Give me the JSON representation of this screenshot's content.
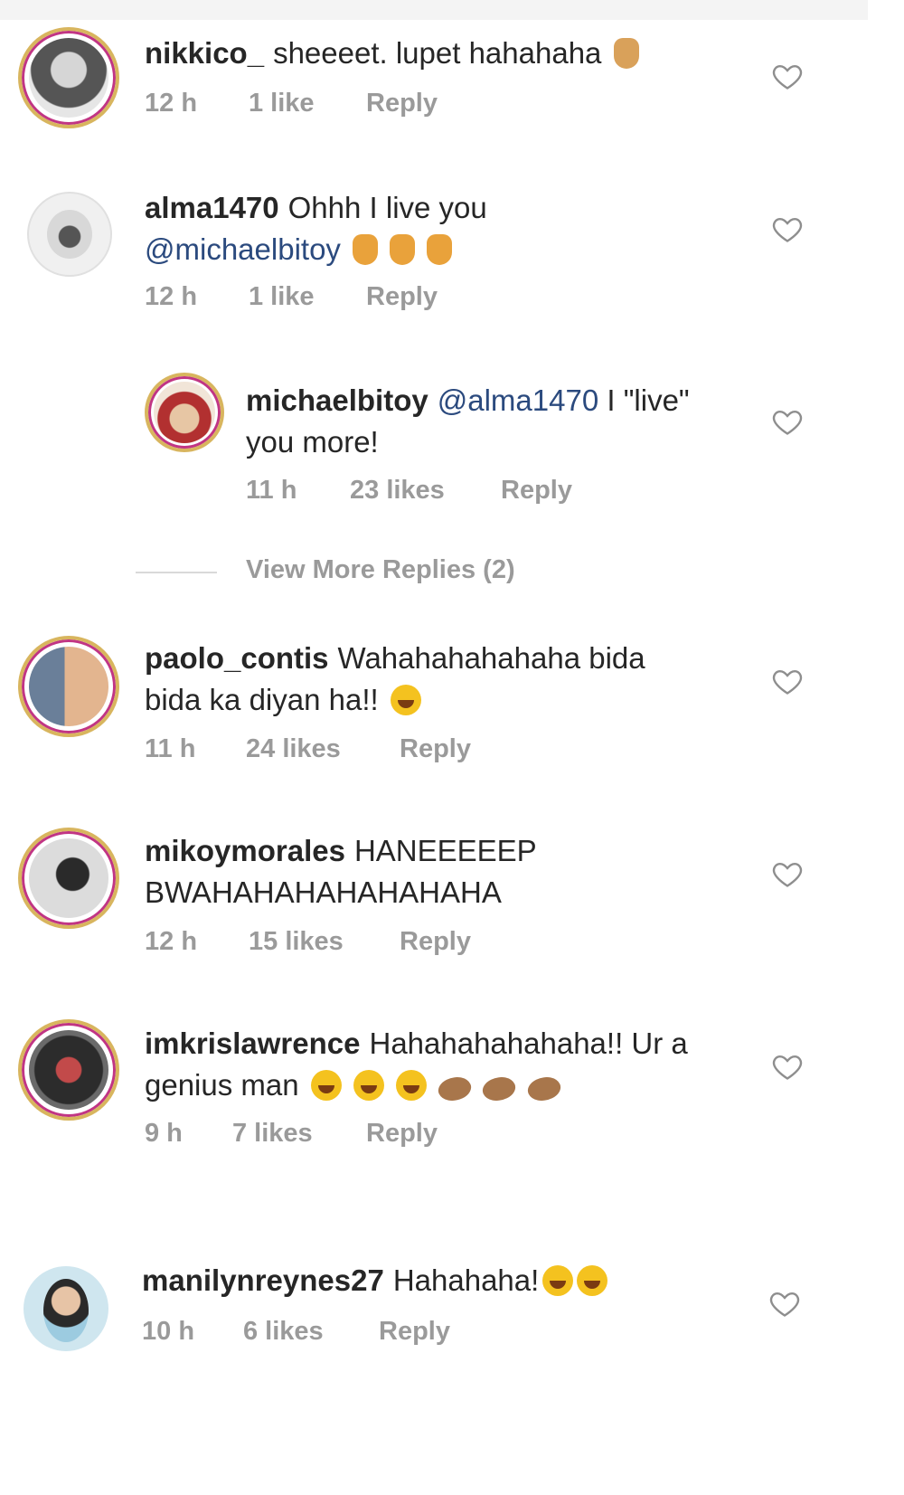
{
  "comments": [
    {
      "username": "nikkico_",
      "text": "sheeeet. lupet hahahaha",
      "time": "12 h",
      "likes": "1 like",
      "reply": "Reply",
      "emojis": [
        "rock-hand"
      ]
    },
    {
      "username": "alma1470",
      "text": "Ohhh I live you",
      "mention": "@michaelbitoy",
      "time": "12 h",
      "likes": "1 like",
      "reply": "Reply",
      "emojis": [
        "hand",
        "hand",
        "hand"
      ]
    },
    {
      "username": "michaelbitoy",
      "mention": "@alma1470",
      "text": "I \"live\"",
      "text_line2": "you more!",
      "time": "11 h",
      "likes": "23 likes",
      "reply": "Reply",
      "is_reply": true
    },
    {
      "username": "paolo_contis",
      "text": "Wahahahahahaha bida",
      "text_line2": "bida ka diyan ha!!",
      "time": "11 h",
      "likes": "24 likes",
      "reply": "Reply",
      "emojis": [
        "laugh"
      ]
    },
    {
      "username": "mikoymorales",
      "text": "HANEEEEEP",
      "text_line2": "BWAHAHAHAHAHAHAHA",
      "time": "12 h",
      "likes": "15 likes",
      "reply": "Reply"
    },
    {
      "username": "imkrislawrence",
      "text": "Hahahahahahaha!! Ur a",
      "text_line2": "genius man",
      "time": "9 h",
      "likes": "7 likes",
      "reply": "Reply",
      "emojis": [
        "laugh",
        "laugh",
        "laugh",
        "clap",
        "clap",
        "clap"
      ]
    },
    {
      "username": "manilynreynes27",
      "text": "Hahahaha!",
      "time": "10 h",
      "likes": "6 likes",
      "reply": "Reply",
      "emojis": [
        "laugh",
        "laugh"
      ]
    }
  ],
  "view_more_replies": "View More Replies (2)",
  "colors": {
    "username": "#262626",
    "meta": "#9a9a9a",
    "mention": "#2b4a7e",
    "story_ring": "#c13584"
  }
}
